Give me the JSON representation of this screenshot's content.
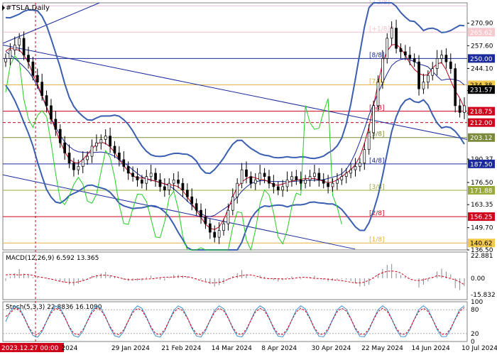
{
  "chart_data": [
    {
      "type": "candlestick",
      "title": "#TSLA,Daily",
      "price_axis": {
        "min": 136.5,
        "max": 283.0
      },
      "price_tick_labels": [
        "270.90",
        "257.60",
        "244.10",
        "231.0",
        "217.63",
        "190.37",
        "176.50",
        "163.35",
        "149.70",
        "136.50"
      ],
      "price_tags": [
        {
          "value": 265.62,
          "label": "265.62",
          "color": "#f6c9cf",
          "text_color": "#ffffff"
        },
        {
          "value": 250.0,
          "label": "250.00",
          "color": "#1a2a9c",
          "text_color": "#ffffff"
        },
        {
          "value": 234.38,
          "label": "234.38",
          "color": "#f2c94c",
          "text_color": "#000000"
        },
        {
          "value": 231.57,
          "label": "231.57",
          "color": "#000000",
          "text_color": "#ffffff"
        },
        {
          "value": 218.75,
          "label": "218.75",
          "color": "#d0021b",
          "text_color": "#ffffff"
        },
        {
          "value": 212.0,
          "label": "212.00",
          "color": "#d0021b",
          "text_color": "#ffffff"
        },
        {
          "value": 203.12,
          "label": "203.12",
          "color": "#7a8a3a",
          "text_color": "#ffffff"
        },
        {
          "value": 187.5,
          "label": "187.50",
          "color": "#1a2a9c",
          "text_color": "#ffffff"
        },
        {
          "value": 171.88,
          "label": "171.88",
          "color": "#9aaa3a",
          "text_color": "#ffffff"
        },
        {
          "value": 156.25,
          "label": "156.25",
          "color": "#d0021b",
          "text_color": "#ffffff"
        },
        {
          "value": 140.62,
          "label": "140.62",
          "color": "#f2c94c",
          "text_color": "#000000"
        }
      ],
      "murrey_levels": [
        {
          "label": "[+2/8]",
          "value": 281.25,
          "color": "#e6b7d6"
        },
        {
          "label": "[+1/8]P",
          "value": 265.62,
          "color": "#f3c0c8"
        },
        {
          "label": "[8/8]",
          "value": 250.0,
          "color": "#1a2a9c"
        },
        {
          "label": "[7/8]",
          "value": 234.38,
          "color": "#e3b23c"
        },
        {
          "label": "[6/8]",
          "value": 218.75,
          "color": "#d0021b"
        },
        {
          "label": "[5/8]",
          "value": 203.12,
          "color": "#7a8a3a"
        },
        {
          "label": "[4/8]",
          "value": 187.5,
          "color": "#1a2a9c"
        },
        {
          "label": "[3/8]",
          "value": 171.88,
          "color": "#9aaa3a"
        },
        {
          "label": "[2/8]",
          "value": 156.25,
          "color": "#d0021b"
        },
        {
          "label": "[1/8]",
          "value": 140.62,
          "color": "#e3b23c"
        }
      ],
      "dashed_level": {
        "value": 212.0,
        "color": "#d0021b"
      },
      "x_tick_labels": [
        "2023.12.27 00:00",
        "2024",
        "29 Jan 2024",
        "21 Feb 2024",
        "14 Mar 2024",
        "8 Apr 2024",
        "30 Apr 2024",
        "22 May 2024",
        "14 Jun 2024",
        "10 Jul 2024"
      ],
      "close_series": [
        250,
        255,
        258,
        262,
        252,
        248,
        240,
        236,
        228,
        222,
        214,
        208,
        200,
        194,
        188,
        184,
        186,
        190,
        192,
        198,
        200,
        202,
        204,
        198,
        194,
        190,
        186,
        182,
        180,
        178,
        176,
        180,
        182,
        178,
        174,
        172,
        176,
        178,
        176,
        172,
        168,
        164,
        160,
        156,
        152,
        147,
        144,
        148,
        152,
        160,
        168,
        176,
        184,
        180,
        176,
        178,
        182,
        180,
        176,
        174,
        172,
        174,
        178,
        180,
        178,
        176,
        178,
        180,
        182,
        178,
        176,
        174,
        176,
        178,
        180,
        182,
        184,
        186,
        188,
        196,
        206,
        222,
        236,
        250,
        262,
        268,
        256,
        254,
        252,
        250,
        248,
        232,
        236,
        240,
        244,
        250,
        252,
        248,
        244,
        222,
        218,
        222
      ]
    },
    {
      "type": "line",
      "title": "MACD(12,26,9) 6.592 13.365",
      "y_tick_labels": [
        "22.881",
        "0.00",
        "-15.832"
      ]
    },
    {
      "type": "line",
      "title": "Stoch(5,3,3) 22.8836 16.1090",
      "y_tick_labels": [
        "100",
        "80",
        "20",
        "0"
      ]
    }
  ]
}
